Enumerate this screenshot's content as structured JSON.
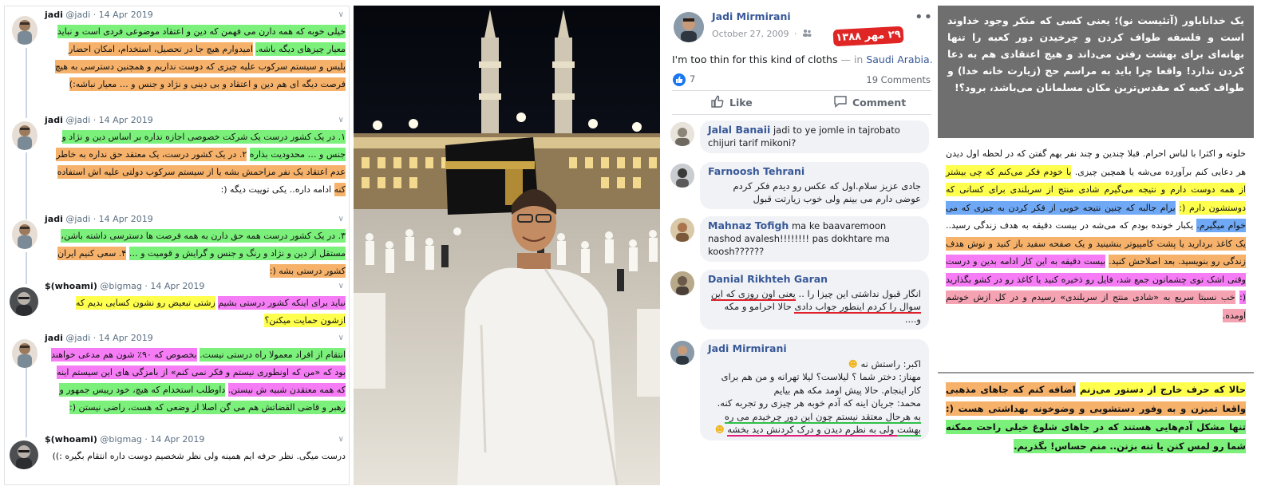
{
  "twitter": {
    "tweets": [
      {
        "name": "jadi",
        "handle": "@jadi",
        "date": "· 14 Apr 2019",
        "chunks": [
          {
            "t": "خیلی خوبه که همه دارن می فهمن که دین و اعتقاد موضوعی فردی است و نباید معیار چیزهای دیگه باشه.",
            "c": "hg"
          },
          {
            "t": " ",
            "c": ""
          },
          {
            "t": "امیدوارم هیچ جا در تحصیل، استخدام، امکان احضار پلیس و سیستم سرکوب علیه چیزی که دوست نداریم و همچنین دسترسی به هیچ فرصت دیگه ای هم دین و اعتقاد و بی دینی و نژاد و جنس و … معیار نباشه:)",
            "c": "ho"
          }
        ]
      },
      {
        "name": "jadi",
        "handle": "@jadi",
        "date": "· 14 Apr 2019",
        "chunks": [
          {
            "t": "۱. در یک کشور درست یک شرکت خصوصی اجازه نداره بر اساس دین و نژاد و جنس و … محدودیت بذاره",
            "c": "hg"
          },
          {
            "t": " ",
            "c": ""
          },
          {
            "t": "۲. در یک کشور درست، یک معتقد حق نداره به خاطر عدم اعتقاد یک نفر مزاحمش بشه یا از سیستم سرکوب دولتی علیه اش استفاده کنه",
            "c": "ho"
          },
          {
            "t": " ادامه داره.. یکی توییت دیگه (:",
            "c": ""
          }
        ]
      },
      {
        "name": "jadi",
        "handle": "@jadi",
        "date": "· 14 Apr 2019",
        "chunks": [
          {
            "t": "۳. در یک کشور درست همه حق دارن به همه فرصت ها دسترسی داشته باشن، مستقل از دین و نژاد و رنگ و جنس و گرایش و قومیت و …",
            "c": "hg"
          },
          {
            "t": " ",
            "c": ""
          },
          {
            "t": "۴. سعی کنیم ایران کشور درستی بشه (:",
            "c": "ho"
          }
        ]
      },
      {
        "name": "$(whoami)",
        "handle": "@bigmag",
        "date": "· 14 Apr 2019",
        "chunks": [
          {
            "t": "نباید برای اینکه کشور درستی بشیم",
            "c": "hm"
          },
          {
            "t": " ",
            "c": ""
          },
          {
            "t": "زشتی تبعیض رو نشون کسایی بدیم که ازشون حمایت میکنن؟",
            "c": "hy"
          }
        ]
      },
      {
        "name": "jadi",
        "handle": "@jadi",
        "date": "· 14 Apr 2019",
        "chunks": [
          {
            "t": "انتقام از افراد معمولا راه درستی نیست.",
            "c": "hg"
          },
          {
            "t": " ",
            "c": ""
          },
          {
            "t": "بخصوص که ۹۰٪ شون هم مدعی خواهند بود که «من که اونطوری نیستم و فکر نمی کنم» از بامزگی های این سیستم اینه که همه معتقدن شبیه ش نیستن.",
            "c": "hm"
          },
          {
            "t": " ",
            "c": ""
          },
          {
            "t": "داوطلب استخدام که هیچ، خود رییس جمهور و رهبر و قاضی القضاتش هم می گن اصلا از وضعی که هست، راضی نیستن (:",
            "c": "hg"
          }
        ]
      },
      {
        "name": "$(whoami)",
        "handle": "@bigmag",
        "date": "· 14 Apr 2019",
        "chunks": [
          {
            "t": "درست میگی. نظر حرفه ایم همینه ولی نظر شخصیم دوست داره انتقام بگیره :))",
            "c": ""
          }
        ]
      }
    ]
  },
  "facebook": {
    "post": {
      "author": "Jadi Mirmirani",
      "date": "October 27, 2009",
      "audience_icon": "friends-icon",
      "overlay_date": "۲۹ مهر ۱۳۸۸",
      "more_icon": "more-icon",
      "text": "I'm too thin for this kind of cloths",
      "place_prefix": "— in",
      "place": "Saudi Arabia.",
      "reactions": "7",
      "comments_count": "19 Comments",
      "like_label": "Like",
      "comment_label": "Comment"
    },
    "comments": [
      {
        "name": "Jalal Banaii",
        "text": "jadi to ye jomle in tajrobato chijuri tarif mikoni?"
      },
      {
        "name": "Farnoosh Tehrani",
        "text": "جادی عزیز سلام.اول که عکس رو دیدم فکر کردم عوضی دارم می بینم ولی خوب زیارتت قبول"
      },
      {
        "name": "Mahnaz Tofigh",
        "text": "ma ke baavaremoon nashod avalesh!!!!!!!! pas dokhtare ma koosh??????"
      },
      {
        "name": "Danial Rikhteh Garan",
        "text_a": "انگار قبول نداشتی این چیزا را .. ",
        "text_b": "یعنی اون روزی که این سوال را کردم اینطور جواب دادی",
        "text_c": " حالا احرامو و مکه و...."
      },
      {
        "name": "Jadi Mirmirani",
        "line1": "اکبر: راستش نه",
        "line2": "مهناز: دختر شما ؟ لیلاست؟ لیلا تهرانه و من هم برای کار اینجام. حالا پیش اومد مکه هم بیایم",
        "line3": "محمد: جریان اینه که آدم خوبه هر چیزی رو تجربه کنه. ",
        "line4": "به هرحال معتقد نیستم چون این دور چرخیدم می ره بهشت",
        "line5": " ولی به نظرم دیدن و درک کردنش دید بخشه"
      }
    ]
  },
  "essay": {
    "title": "یک خداناباور (آتئیست نو)؛ یعنی کسی که منکر وجود خداوند است و فلسفه طواف کردن و چرخیدن دور کعبه را تنها بهانه‌ای برای بهشت رفتن می‌داند و هیچ اعتقادی هم به دعا کردن ندارد! واقعا چرا باید به مراسم حج (زیارت خانه خدا) و طواف کعبه که مقدس‌ترین مکان مسلمانان می‌باشد، برود؟!",
    "middle": [
      {
        "t": "خلوته و اکثرا با لباس احرام. قبلا چندین و چند نفر بهم گفتن که در لحظه اول دیدن هر دعایی کنم برآورده می‌شه یا همچین چیزی. ",
        "c": ""
      },
      {
        "t": "با خودم فکر می‌کنم که چی بیشتر از همه دوست دارم و نتیجه می‌گیرم شادی منتج از سربلندی برای کسانی که دوستشون دارم (:",
        "c": "hy"
      },
      {
        "t": " ",
        "c": ""
      },
      {
        "t": "برام جالبه که چنین نتیجه خوبی از فکر کردن به چیزی که می خوام میگیرم.",
        "c": "hb"
      },
      {
        "t": " یکبار خونده بودم که می‌شه در بیست دقیقه به هدف زندگی رسید.. ",
        "c": ""
      },
      {
        "t": "یک کاغذ بردارید یا پشت کامپیوتر بنشینید و یک صفحه سفید باز کنید و توش هدف زندگی رو بنویسید. بعد اصلاحش کنید.",
        "c": "ho"
      },
      {
        "t": " ",
        "c": ""
      },
      {
        "t": "بیست دقیقه به این کار ادامه بدین و درست وقتی اشک توی چشماتون جمع شد، فایل رو ذخیره کنید یا کاغذ رو در کشو بگذارید (:",
        "c": "hm"
      },
      {
        "t": " ",
        "c": ""
      },
      {
        "t": "خب نسبتا سریع به «شادی منتج از سربلندی» رسیدم و در کل ازش خوشم اومده.",
        "c": "hp"
      }
    ],
    "bottom": [
      {
        "t": "حالا که حرف خارج از دستور می‌زنم",
        "c": "hy"
      },
      {
        "t": " ",
        "c": ""
      },
      {
        "t": "اضافه کنم که جاهای مذهبی واقعا تمیزن و به وفور دستشویی و وضوخونه بهداشتی هست (:",
        "c": "ho"
      },
      {
        "t": " ",
        "c": ""
      },
      {
        "t": "تنها مشکل آدم‌هایی هستند که در جاهای شلوغ خیلی راحت ممکنه شما رو لمس کنن یا تنه بزنن.. منم حساس! بگذریم.",
        "c": "hg"
      }
    ]
  },
  "colors": {
    "green": "#7bf07b",
    "orange": "#f6b26b",
    "magenta": "#f57cf5",
    "yellow": "#ffff4d",
    "blue": "#6fa8f5",
    "pink": "#f5a3b3",
    "facebook_link": "#385898",
    "overlay_red": "#e02525",
    "title_bar": "#6f6f6f"
  }
}
